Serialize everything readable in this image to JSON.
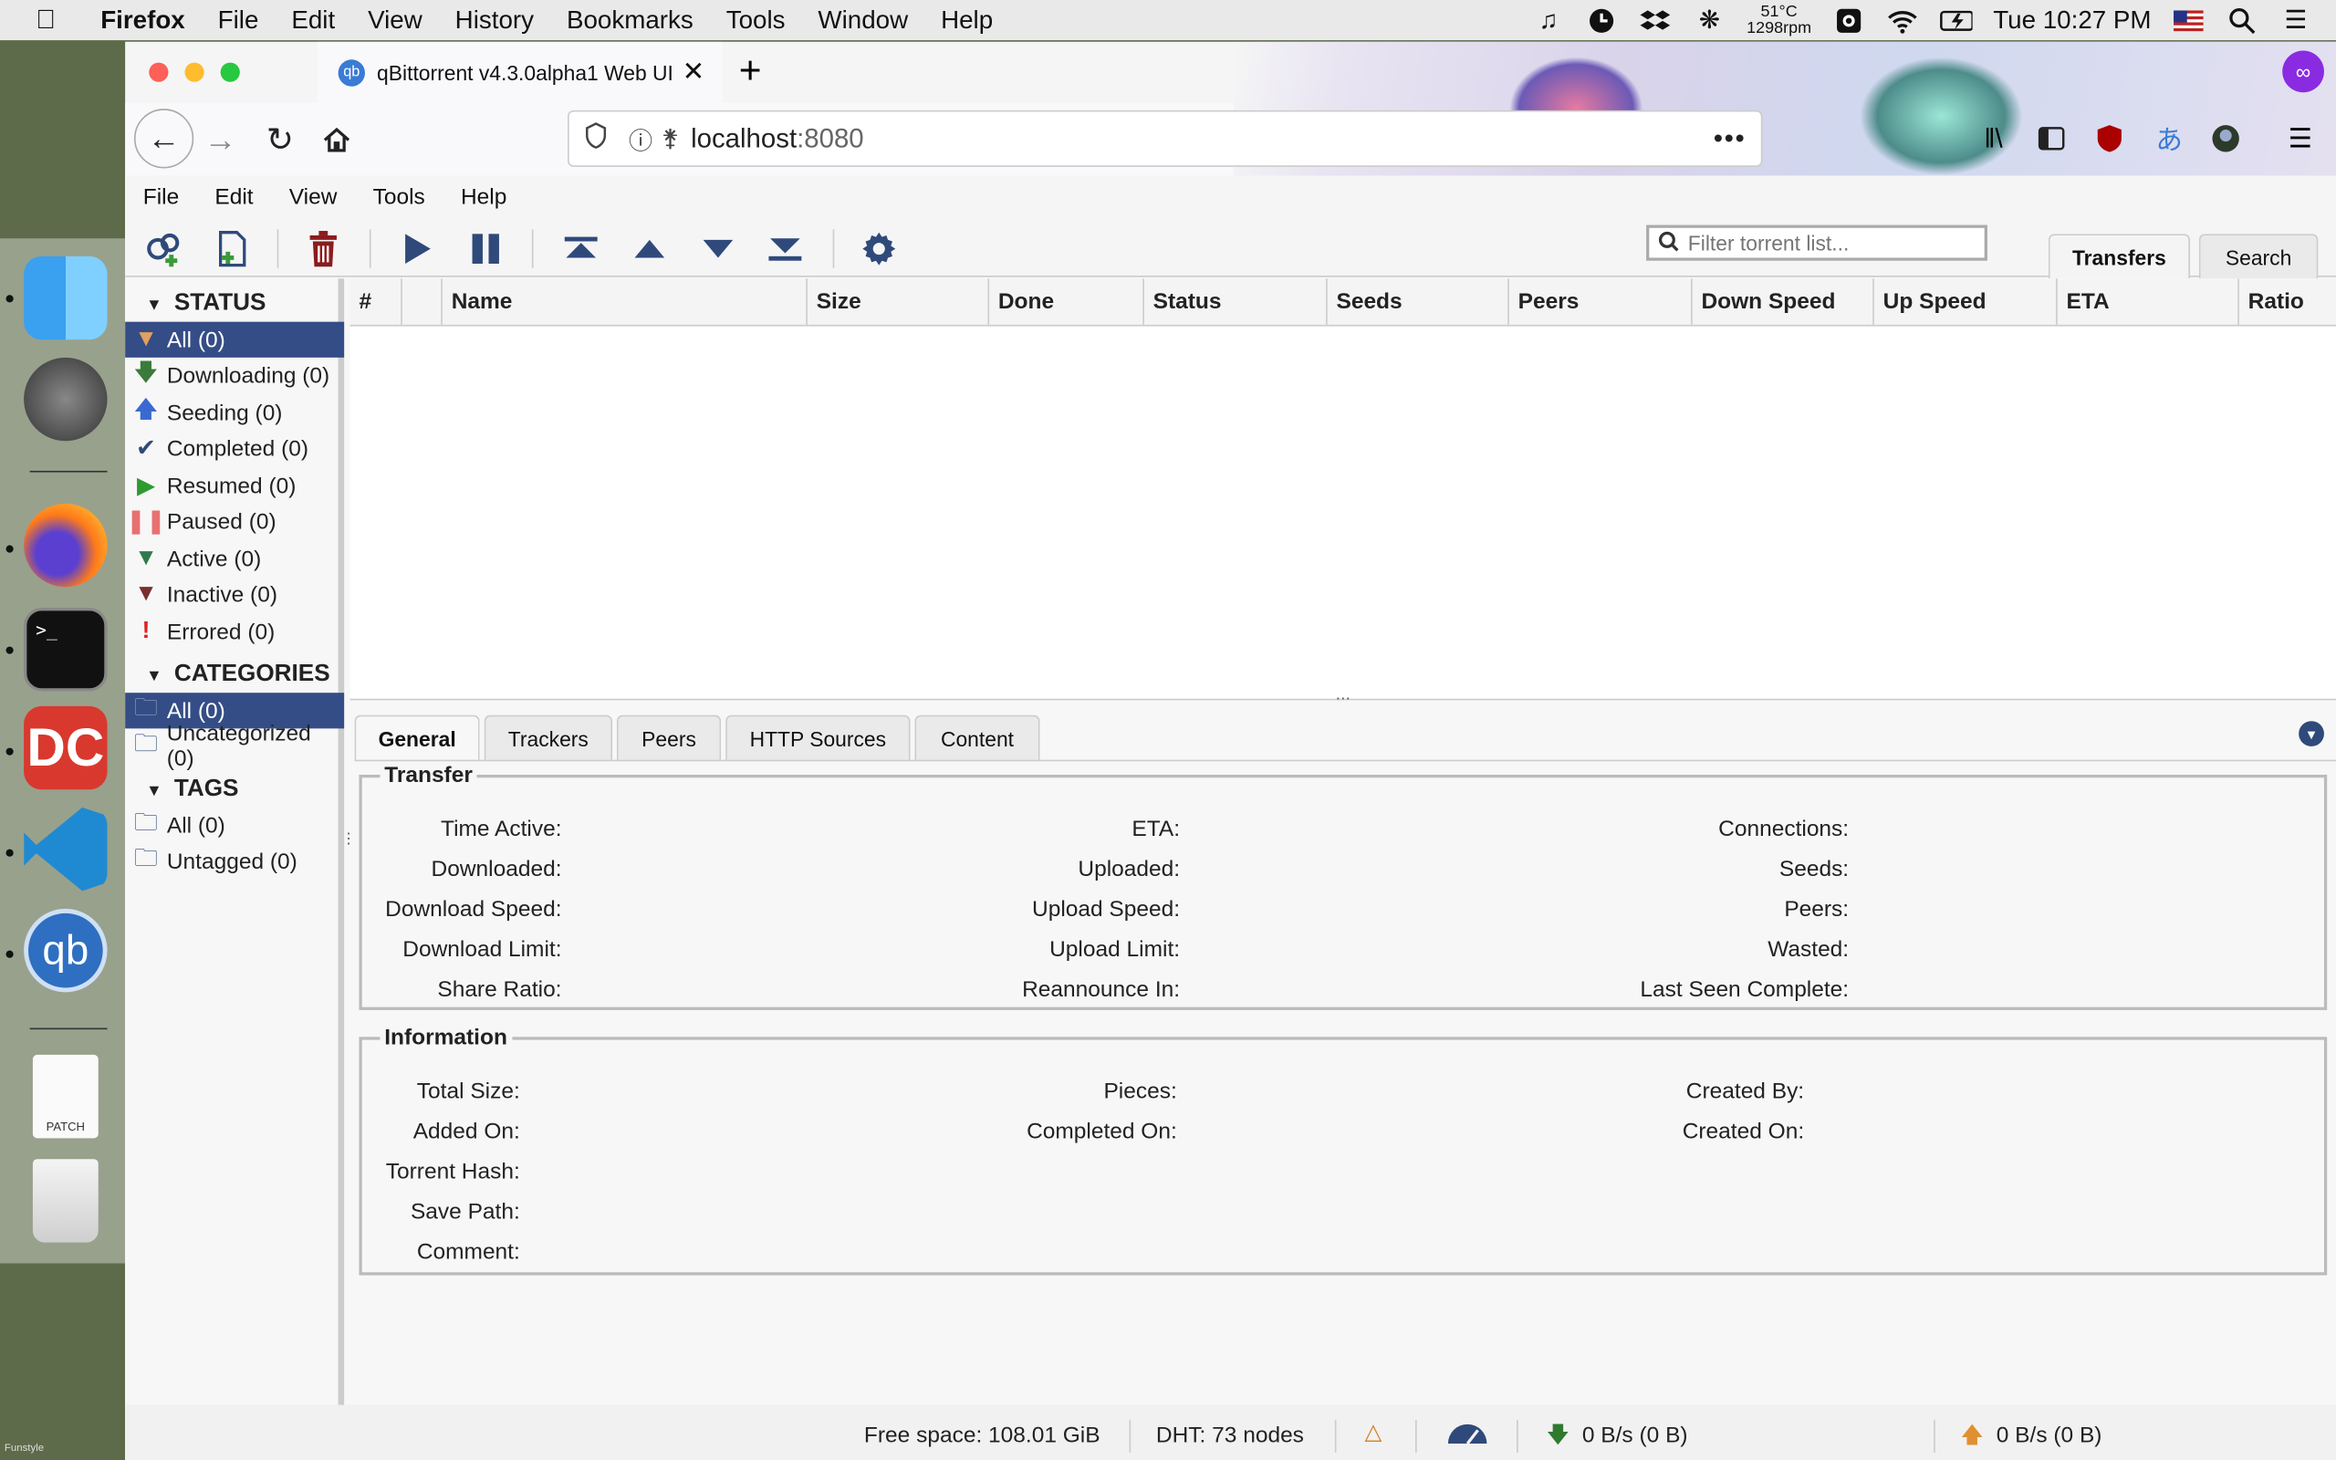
{
  "macos": {
    "app_name": "Firefox",
    "menus": [
      "File",
      "Edit",
      "View",
      "History",
      "Bookmarks",
      "Tools",
      "Window",
      "Help"
    ],
    "temp": "51°C",
    "rpm": "1298rpm",
    "clock": "Tue 10:27 PM"
  },
  "dock": {
    "label": "Funstyle",
    "patch_label": "PATCH"
  },
  "browser": {
    "tab_title": "qBittorrent v4.3.0alpha1 Web UI",
    "url_host": "localhost",
    "url_port": ":8080"
  },
  "qb": {
    "menus": [
      "File",
      "Edit",
      "View",
      "Tools",
      "Help"
    ],
    "filter_placeholder": "Filter torrent list...",
    "view_tabs": {
      "transfers": "Transfers",
      "search": "Search"
    },
    "status": {
      "heading": "STATUS",
      "items": [
        "All (0)",
        "Downloading (0)",
        "Seeding (0)",
        "Completed (0)",
        "Resumed (0)",
        "Paused (0)",
        "Active (0)",
        "Inactive (0)",
        "Errored (0)"
      ]
    },
    "categories": {
      "heading": "CATEGORIES",
      "items": [
        "All (0)",
        "Uncategorized (0)"
      ]
    },
    "tags": {
      "heading": "TAGS",
      "items": [
        "All (0)",
        "Untagged (0)"
      ]
    },
    "columns": [
      "#",
      "",
      "Name",
      "Size",
      "Done",
      "Status",
      "Seeds",
      "Peers",
      "Down Speed",
      "Up Speed",
      "ETA",
      "Ratio"
    ],
    "prop_tabs": [
      "General",
      "Trackers",
      "Peers",
      "HTTP Sources",
      "Content"
    ],
    "transfer": {
      "legend": "Transfer",
      "col1": [
        "Time Active:",
        "Downloaded:",
        "Download Speed:",
        "Download Limit:",
        "Share Ratio:"
      ],
      "col2": [
        "ETA:",
        "Uploaded:",
        "Upload Speed:",
        "Upload Limit:",
        "Reannounce In:"
      ],
      "col3": [
        "Connections:",
        "Seeds:",
        "Peers:",
        "Wasted:",
        "Last Seen Complete:"
      ]
    },
    "information": {
      "legend": "Information",
      "col1": [
        "Total Size:",
        "Added On:",
        "Torrent Hash:",
        "Save Path:",
        "Comment:"
      ],
      "col2": [
        "Pieces:",
        "Completed On:"
      ],
      "col3": [
        "Created By:",
        "Created On:"
      ]
    },
    "statusbar": {
      "free_space": "Free space: 108.01 GiB",
      "dht": "DHT: 73 nodes",
      "down": "0 B/s (0 B)",
      "up": "0 B/s (0 B)"
    }
  }
}
